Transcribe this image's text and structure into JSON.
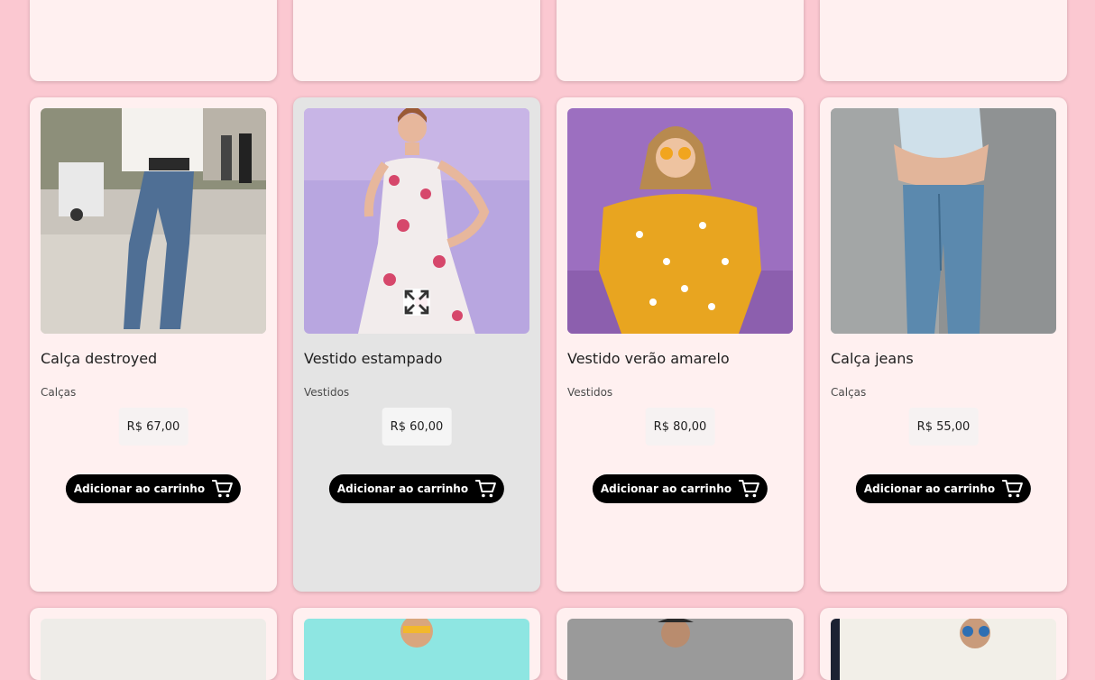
{
  "products": [
    {
      "title": "Calça destroyed",
      "category": "Calças",
      "price": "R$ 67,00",
      "button_label": "Adicionar ao carrinho",
      "image_icon": "product-photo-jeans-street"
    },
    {
      "title": "Vestido estampado",
      "category": "Vestidos",
      "price": "R$ 60,00",
      "button_label": "Adicionar ao carrinho",
      "image_icon": "product-photo-floral-dress",
      "hover_icon": "expand-icon"
    },
    {
      "title": "Vestido verão amarelo",
      "category": "Vestidos",
      "price": "R$ 80,00",
      "button_label": "Adicionar ao carrinho",
      "image_icon": "product-photo-yellow-dress"
    },
    {
      "title": "Calça jeans",
      "category": "Calças",
      "price": "R$ 55,00",
      "button_label": "Adicionar ao carrinho",
      "image_icon": "product-photo-jeans-grey"
    }
  ],
  "colors": {
    "page_background": "#fbc8d1",
    "card_background": "#fff0f0",
    "card_hover_background": "#e4e4e4",
    "button_background": "#000000",
    "button_text": "#ffffff"
  }
}
